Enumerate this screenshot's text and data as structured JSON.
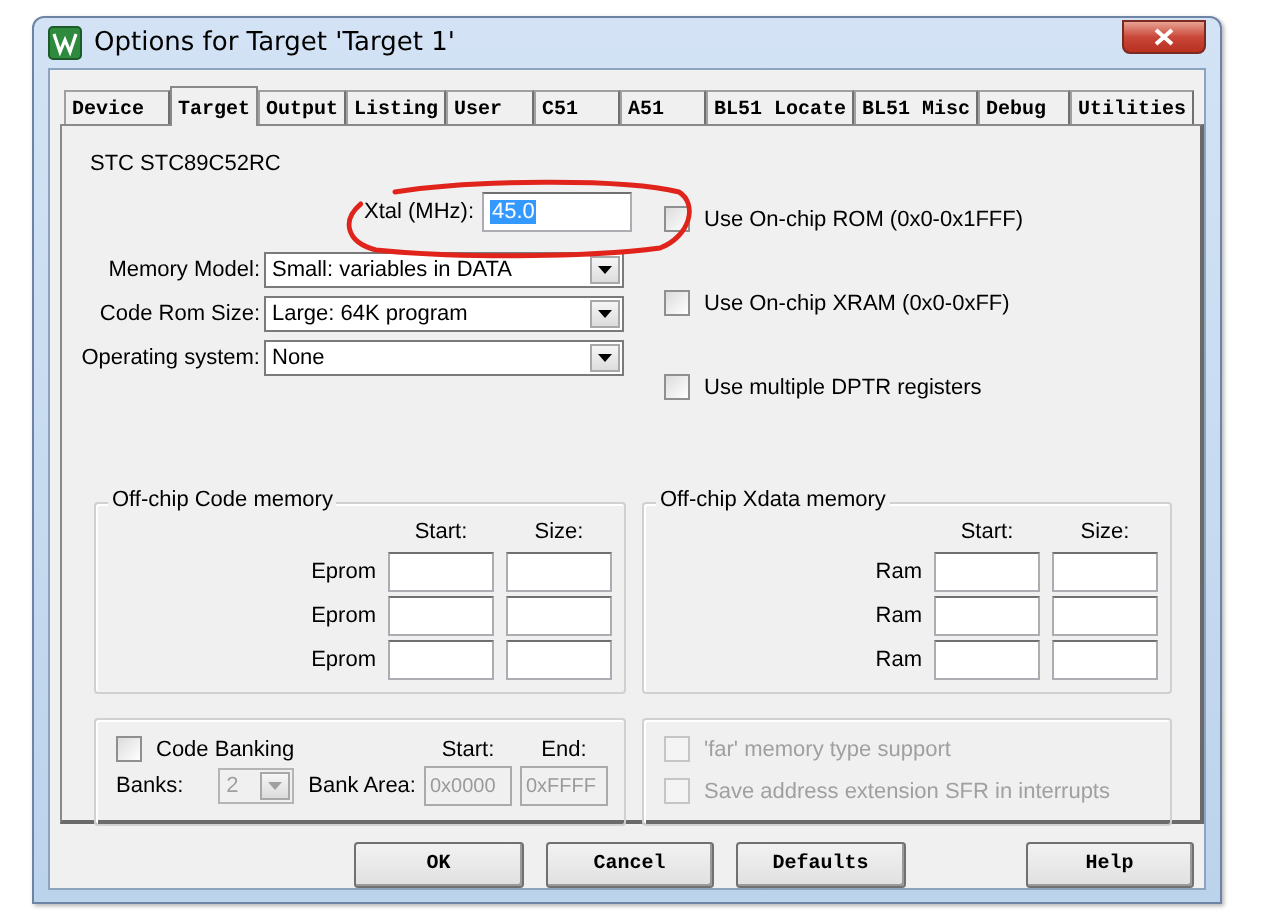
{
  "window": {
    "title": "Options for Target 'Target 1'"
  },
  "tabs": [
    {
      "label": "Device",
      "selected": false
    },
    {
      "label": "Target",
      "selected": true
    },
    {
      "label": "Output",
      "selected": false
    },
    {
      "label": "Listing",
      "selected": false
    },
    {
      "label": "User",
      "selected": false
    },
    {
      "label": "C51",
      "selected": false
    },
    {
      "label": "A51",
      "selected": false
    },
    {
      "label": "BL51 Locate",
      "selected": false
    },
    {
      "label": "BL51 Misc",
      "selected": false
    },
    {
      "label": "Debug",
      "selected": false
    },
    {
      "label": "Utilities",
      "selected": false
    }
  ],
  "device": "STC STC89C52RC",
  "xtal": {
    "label": "Xtal (MHz):",
    "value": "45.0"
  },
  "dropdowns": [
    {
      "label": "Memory Model:",
      "value": "Small: variables in DATA"
    },
    {
      "label": "Code Rom Size:",
      "value": "Large: 64K program"
    },
    {
      "label": "Operating system:",
      "value": "None"
    }
  ],
  "options": [
    {
      "label": "Use On-chip ROM (0x0-0x1FFF)",
      "checked": false
    },
    {
      "label": "Use On-chip XRAM (0x0-0xFF)",
      "checked": false
    },
    {
      "label": "Use multiple DPTR registers",
      "checked": false
    }
  ],
  "memory_groups": [
    {
      "title": "Off-chip Code memory",
      "headers": [
        "Start:",
        "Size:"
      ],
      "rows": [
        "Eprom",
        "Eprom",
        "Eprom"
      ]
    },
    {
      "title": "Off-chip Xdata memory",
      "headers": [
        "Start:",
        "Size:"
      ],
      "rows": [
        "Ram",
        "Ram",
        "Ram"
      ]
    }
  ],
  "code_banking": {
    "label": "Code Banking",
    "checked": false,
    "banks_label": "Banks:",
    "banks": {
      "value": "2",
      "disabled": true
    },
    "start_header": "Start:",
    "end_header": "End:",
    "area_label": "Bank Area:",
    "start": {
      "value": "0x0000",
      "disabled": true
    },
    "end": {
      "value": "0xFFFF",
      "disabled": true
    }
  },
  "far_options": [
    {
      "label": "'far' memory type support",
      "checked": false,
      "disabled": true
    },
    {
      "label": "Save address extension SFR in interrupts",
      "checked": false,
      "disabled": true
    }
  ],
  "buttons": [
    "OK",
    "Cancel",
    "Defaults",
    "Help"
  ]
}
